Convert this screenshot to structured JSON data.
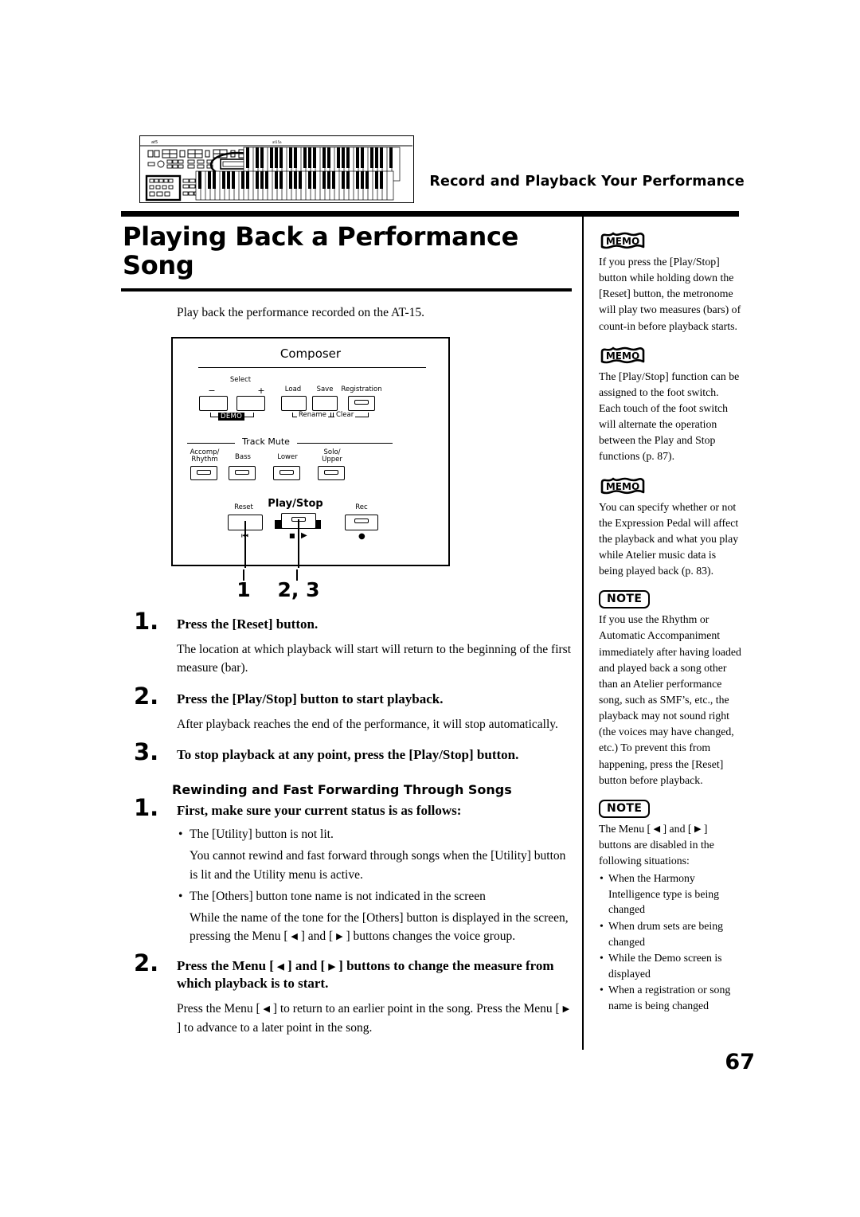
{
  "header": {
    "running_head": "Record and Playback Your Performance",
    "illustration_name": "at-15-organ-front-panel"
  },
  "page": {
    "title": "Playing Back a Performance Song",
    "intro": "Play back the performance recorded on the AT-15.",
    "page_number": "67"
  },
  "figure": {
    "panel_title": "Composer",
    "select_group": {
      "label": "Select",
      "minus": "−",
      "plus": "+",
      "demo": "DEMO"
    },
    "file_buttons": [
      {
        "label": "Load",
        "sub": "Rename",
        "led": false
      },
      {
        "label": "Save",
        "sub": "Clear",
        "led": false
      },
      {
        "label": "Registration",
        "sub": "",
        "led": true
      }
    ],
    "track_mute": {
      "label": "Track Mute",
      "buttons": [
        "Accomp/\nRhythm",
        "Bass",
        "Lower",
        "Solo/\nUpper"
      ]
    },
    "transport": {
      "reset": "Reset",
      "play_stop": "Play/Stop",
      "rec": "Rec",
      "reset_glyph": "⏮",
      "stop_glyph": "■",
      "play_glyph": "▶",
      "rec_glyph": "●"
    },
    "callouts": [
      {
        "label": "1"
      },
      {
        "label": "2, 3"
      }
    ]
  },
  "steps": [
    {
      "num": "1.",
      "head": "Press the [Reset] button.",
      "body": "The location at which playback will start will return to the beginning of the first measure (bar)."
    },
    {
      "num": "2.",
      "head": "Press the [Play/Stop] button to start playback.",
      "body": "After playback reaches the end of the performance, it will stop automatically."
    },
    {
      "num": "3.",
      "head": "To stop playback at any point, press the [Play/Stop] button.",
      "body": ""
    }
  ],
  "section2": {
    "heading": "Rewinding and Fast Forwarding Through Songs",
    "step1": {
      "num": "1.",
      "head": "First, make sure your current status is as follows:",
      "bullets": [
        {
          "lead": "The [Utility] button is not lit.",
          "body": "You cannot rewind and fast forward through songs when the [Utility] button is lit and the Utility menu is active."
        },
        {
          "lead": "The [Others] button tone name is not indicated in the screen",
          "body_pre": "While the name of the tone for the [Others] button is displayed in the screen, pressing the Menu [ ",
          "body_mid": " ] and [ ",
          "body_post": " ] buttons changes the voice group."
        }
      ]
    },
    "step2": {
      "num": "2.",
      "head_pre": "Press the Menu [ ",
      "head_mid": " ] and [ ",
      "head_post": " ] buttons to change the measure from which playback is to start.",
      "body_pre": "Press the Menu [ ",
      "body_mid": " ] to return to an earlier point in the song. Press the Menu [ ",
      "body_post": " ] to advance to a later point in the song."
    }
  },
  "sidebar": [
    {
      "kind": "memo",
      "badge": "MEMO",
      "text": "If you press the [Play/Stop] button while holding down the [Reset] button, the metronome will play two measures (bars) of count-in before playback starts."
    },
    {
      "kind": "memo",
      "badge": "MEMO",
      "text": "The [Play/Stop] function can be assigned to the foot switch. Each touch of the foot switch will alternate the operation between the Play and Stop functions (p. 87)."
    },
    {
      "kind": "memo",
      "badge": "MEMO",
      "text": "You can specify whether or not the Expression Pedal will affect the playback and what you play while Atelier music data is being played back (p. 83)."
    },
    {
      "kind": "note",
      "badge": "NOTE",
      "text": "If you use the Rhythm or Automatic Accompaniment immediately after having loaded and played back a song other than an Atelier performance song, such as SMF’s, etc., the playback may not sound right (the voices may have changed, etc.) To prevent this from happening, press the [Reset] button before playback."
    },
    {
      "kind": "note",
      "badge": "NOTE",
      "text_pre": "The Menu [ ",
      "text_mid": " ] and [ ",
      "text_post": " ] buttons are disabled in the following situations:",
      "bullets": [
        "When the Harmony Intelligence type is being changed",
        "When drum sets are being changed",
        "While the Demo screen is displayed",
        "When a registration or song name is being changed"
      ]
    }
  ],
  "glyphs": {
    "left_tri": "◀",
    "right_tri": "▶",
    "bullet": "•"
  }
}
